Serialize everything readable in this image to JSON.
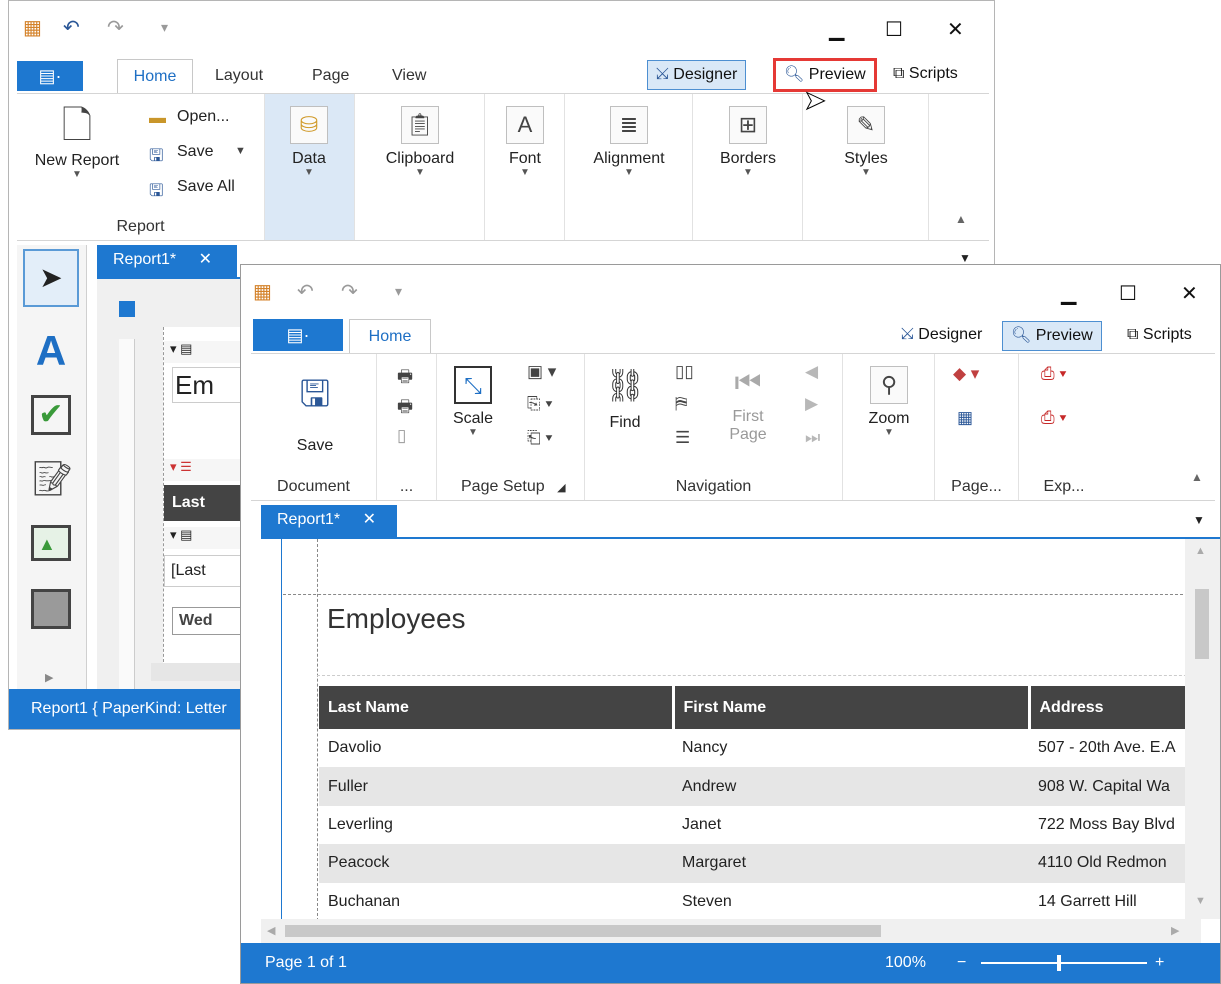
{
  "colors": {
    "accent": "#1e78d0",
    "header_bg": "#444444",
    "highlight": "#e53935"
  },
  "designer": {
    "tabs": [
      "Home",
      "Layout",
      "Page",
      "View"
    ],
    "modes": {
      "designer": "Designer",
      "preview": "Preview",
      "scripts": "Scripts"
    },
    "report_group": {
      "new_report": "New Report",
      "open": "Open...",
      "save": "Save",
      "save_all": "Save All",
      "label": "Report"
    },
    "groups": {
      "data": "Data",
      "clipboard": "Clipboard",
      "font": "Font",
      "alignment": "Alignment",
      "borders": "Borders",
      "styles": "Styles"
    },
    "doc_tab": "Report1*",
    "status": "Report1 { PaperKind: Letter",
    "fragments": {
      "f1": "Em",
      "f2": "Last",
      "f3": "[Last",
      "f4": "Wed"
    }
  },
  "preview": {
    "tab": "Home",
    "modes": {
      "designer": "Designer",
      "preview": "Preview",
      "scripts": "Scripts"
    },
    "groups": {
      "document": "Document",
      "save": "Save",
      "more": "...",
      "scale": "Scale",
      "page_setup": "Page Setup",
      "find": "Find",
      "first_page": "First Page",
      "navigation": "Navigation",
      "zoom": "Zoom",
      "page": "Page...",
      "export": "Exp..."
    },
    "doc_tab": "Report1*",
    "report_title": "Employees",
    "columns": [
      "Last Name",
      "First Name",
      "Address"
    ],
    "rows": [
      [
        "Davolio",
        "Nancy",
        "507 - 20th Ave. E.A"
      ],
      [
        "Fuller",
        "Andrew",
        "908 W. Capital Wa"
      ],
      [
        "Leverling",
        "Janet",
        "722 Moss Bay Blvd"
      ],
      [
        "Peacock",
        "Margaret",
        "4110 Old Redmon"
      ],
      [
        "Buchanan",
        "Steven",
        "14 Garrett Hill"
      ]
    ],
    "status": {
      "page": "Page 1 of 1",
      "zoom": "100%",
      "minus": "−",
      "plus": "+"
    }
  },
  "icons": [
    "undo-icon",
    "redo-icon",
    "close-icon",
    "cursor-icon",
    "save-icon",
    "zoom-icon",
    "binoculars-icon",
    "pdf-icon"
  ]
}
